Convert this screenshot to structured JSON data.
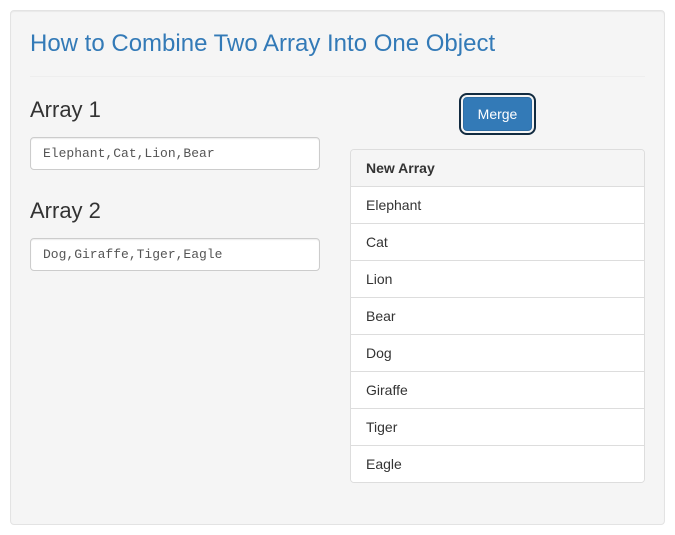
{
  "title": "How to Combine Two Array Into One Object",
  "left": {
    "array1": {
      "label": "Array 1",
      "value": "Elephant,Cat,Lion,Bear"
    },
    "array2": {
      "label": "Array 2",
      "value": "Dog,Giraffe,Tiger,Eagle"
    }
  },
  "merge_label": "Merge",
  "result": {
    "header": "New Array",
    "items": [
      "Elephant",
      "Cat",
      "Lion",
      "Bear",
      "Dog",
      "Giraffe",
      "Tiger",
      "Eagle"
    ]
  }
}
